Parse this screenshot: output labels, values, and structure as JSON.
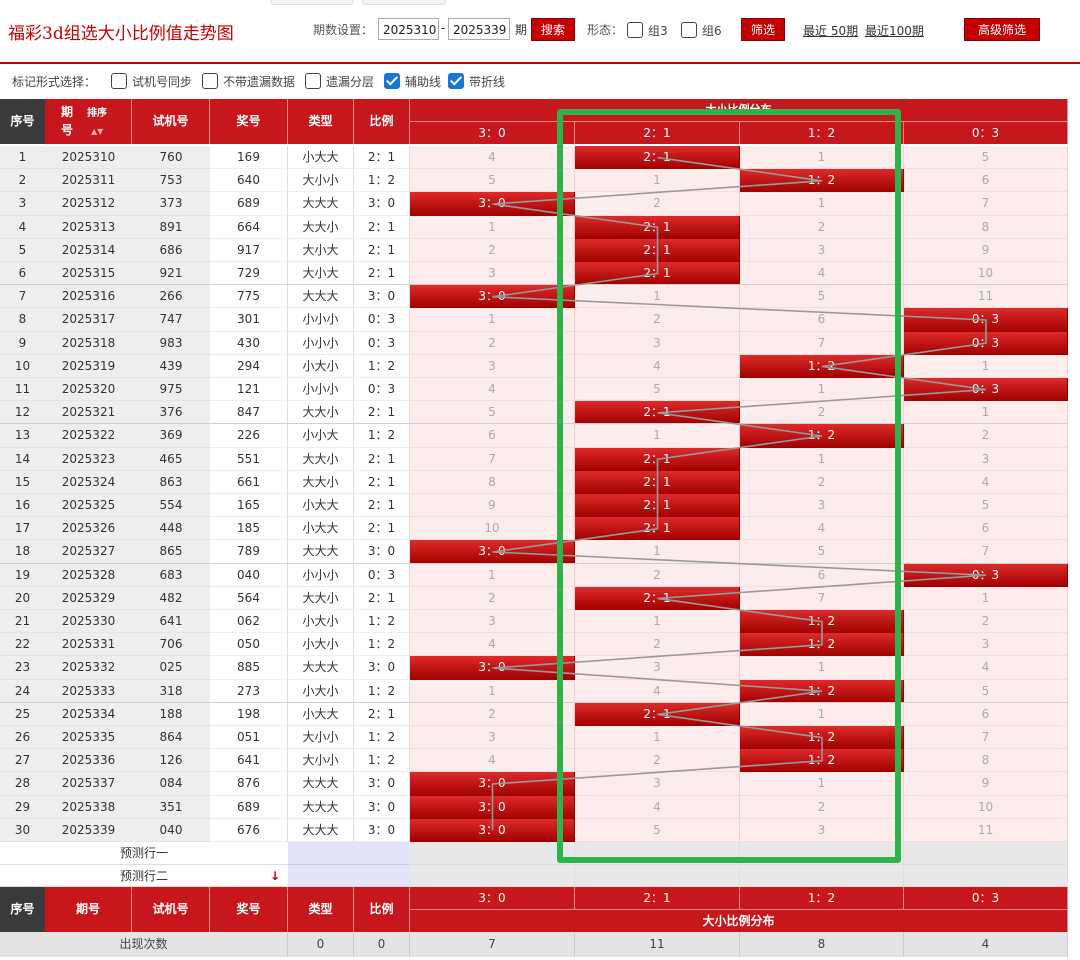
{
  "header": {
    "title": "福彩3d组选大小比例值走势图",
    "period_label": "期数设置：",
    "period_from": "2025310",
    "period_to": "2025339",
    "period_unit": "期",
    "search_button": "搜索",
    "shape_label": "形态：",
    "group3_label": "组3",
    "group6_label": "组6",
    "filter_button": "筛选",
    "recent50": "最近 50期",
    "recent100": "最近100期",
    "advanced_button": "高级筛选"
  },
  "options": {
    "label": "标记形式选择：",
    "items": [
      {
        "label": "试机号同步",
        "checked": false
      },
      {
        "label": "不带遗漏数据",
        "checked": false
      },
      {
        "label": "遗漏分层",
        "checked": false
      },
      {
        "label": "辅助线",
        "checked": true
      },
      {
        "label": "带折线",
        "checked": true
      }
    ]
  },
  "table": {
    "headers": {
      "seq": "序号",
      "period_a": "期",
      "period_b": "号",
      "sort": "排序",
      "trial": "试机号",
      "prize": "奖号",
      "type": "类型",
      "ratio": "比例",
      "dist_title": "大小比例分布"
    },
    "dist_columns": [
      "3：0",
      "2：1",
      "1：2",
      "0：3"
    ],
    "rows": [
      {
        "seq": "1",
        "period": "2025310",
        "trial": "760",
        "prize": "169",
        "type": "小大大",
        "ratio": "2：1",
        "hit": 1,
        "d": [
          "4",
          "2：1",
          "1",
          "5"
        ]
      },
      {
        "seq": "2",
        "period": "2025311",
        "trial": "753",
        "prize": "640",
        "type": "大小小",
        "ratio": "1：2",
        "hit": 2,
        "d": [
          "5",
          "1",
          "1：2",
          "6"
        ]
      },
      {
        "seq": "3",
        "period": "2025312",
        "trial": "373",
        "prize": "689",
        "type": "大大大",
        "ratio": "3：0",
        "hit": 0,
        "d": [
          "3：0",
          "2",
          "1",
          "7"
        ]
      },
      {
        "seq": "4",
        "period": "2025313",
        "trial": "891",
        "prize": "664",
        "type": "大大小",
        "ratio": "2：1",
        "hit": 1,
        "d": [
          "1",
          "2：1",
          "2",
          "8"
        ]
      },
      {
        "seq": "5",
        "period": "2025314",
        "trial": "686",
        "prize": "917",
        "type": "大小大",
        "ratio": "2：1",
        "hit": 1,
        "d": [
          "2",
          "2：1",
          "3",
          "9"
        ]
      },
      {
        "seq": "6",
        "period": "2025315",
        "trial": "921",
        "prize": "729",
        "type": "大小大",
        "ratio": "2：1",
        "hit": 1,
        "d": [
          "3",
          "2：1",
          "4",
          "10"
        ]
      },
      {
        "seq": "7",
        "period": "2025316",
        "trial": "266",
        "prize": "775",
        "type": "大大大",
        "ratio": "3：0",
        "hit": 0,
        "d": [
          "3：0",
          "1",
          "5",
          "11"
        ]
      },
      {
        "seq": "8",
        "period": "2025317",
        "trial": "747",
        "prize": "301",
        "type": "小小小",
        "ratio": "0：3",
        "hit": 3,
        "d": [
          "1",
          "2",
          "6",
          "0：3"
        ]
      },
      {
        "seq": "9",
        "period": "2025318",
        "trial": "983",
        "prize": "430",
        "type": "小小小",
        "ratio": "0：3",
        "hit": 3,
        "d": [
          "2",
          "3",
          "7",
          "0：3"
        ]
      },
      {
        "seq": "10",
        "period": "2025319",
        "trial": "439",
        "prize": "294",
        "type": "小大小",
        "ratio": "1：2",
        "hit": 2,
        "d": [
          "3",
          "4",
          "1：2",
          "1"
        ]
      },
      {
        "seq": "11",
        "period": "2025320",
        "trial": "975",
        "prize": "121",
        "type": "小小小",
        "ratio": "0：3",
        "hit": 3,
        "d": [
          "4",
          "5",
          "1",
          "0：3"
        ]
      },
      {
        "seq": "12",
        "period": "2025321",
        "trial": "376",
        "prize": "847",
        "type": "大大小",
        "ratio": "2：1",
        "hit": 1,
        "d": [
          "5",
          "2：1",
          "2",
          "1"
        ]
      },
      {
        "seq": "13",
        "period": "2025322",
        "trial": "369",
        "prize": "226",
        "type": "小小大",
        "ratio": "1：2",
        "hit": 2,
        "d": [
          "6",
          "1",
          "1：2",
          "2"
        ]
      },
      {
        "seq": "14",
        "period": "2025323",
        "trial": "465",
        "prize": "551",
        "type": "大大小",
        "ratio": "2：1",
        "hit": 1,
        "d": [
          "7",
          "2：1",
          "1",
          "3"
        ]
      },
      {
        "seq": "15",
        "period": "2025324",
        "trial": "863",
        "prize": "661",
        "type": "大大小",
        "ratio": "2：1",
        "hit": 1,
        "d": [
          "8",
          "2：1",
          "2",
          "4"
        ]
      },
      {
        "seq": "16",
        "period": "2025325",
        "trial": "554",
        "prize": "165",
        "type": "小大大",
        "ratio": "2：1",
        "hit": 1,
        "d": [
          "9",
          "2：1",
          "3",
          "5"
        ]
      },
      {
        "seq": "17",
        "period": "2025326",
        "trial": "448",
        "prize": "185",
        "type": "小大大",
        "ratio": "2：1",
        "hit": 1,
        "d": [
          "10",
          "2：1",
          "4",
          "6"
        ]
      },
      {
        "seq": "18",
        "period": "2025327",
        "trial": "865",
        "prize": "789",
        "type": "大大大",
        "ratio": "3：0",
        "hit": 0,
        "d": [
          "3：0",
          "1",
          "5",
          "7"
        ]
      },
      {
        "seq": "19",
        "period": "2025328",
        "trial": "683",
        "prize": "040",
        "type": "小小小",
        "ratio": "0：3",
        "hit": 3,
        "d": [
          "1",
          "2",
          "6",
          "0：3"
        ]
      },
      {
        "seq": "20",
        "period": "2025329",
        "trial": "482",
        "prize": "564",
        "type": "大大小",
        "ratio": "2：1",
        "hit": 1,
        "d": [
          "2",
          "2：1",
          "7",
          "1"
        ]
      },
      {
        "seq": "21",
        "period": "2025330",
        "trial": "641",
        "prize": "062",
        "type": "小大小",
        "ratio": "1：2",
        "hit": 2,
        "d": [
          "3",
          "1",
          "1：2",
          "2"
        ]
      },
      {
        "seq": "22",
        "period": "2025331",
        "trial": "706",
        "prize": "050",
        "type": "小大小",
        "ratio": "1：2",
        "hit": 2,
        "d": [
          "4",
          "2",
          "1：2",
          "3"
        ]
      },
      {
        "seq": "23",
        "period": "2025332",
        "trial": "025",
        "prize": "885",
        "type": "大大大",
        "ratio": "3：0",
        "hit": 0,
        "d": [
          "3：0",
          "3",
          "1",
          "4"
        ]
      },
      {
        "seq": "24",
        "period": "2025333",
        "trial": "318",
        "prize": "273",
        "type": "小大小",
        "ratio": "1：2",
        "hit": 2,
        "d": [
          "1",
          "4",
          "1：2",
          "5"
        ]
      },
      {
        "seq": "25",
        "period": "2025334",
        "trial": "188",
        "prize": "198",
        "type": "小大大",
        "ratio": "2：1",
        "hit": 1,
        "d": [
          "2",
          "2：1",
          "1",
          "6"
        ]
      },
      {
        "seq": "26",
        "period": "2025335",
        "trial": "864",
        "prize": "051",
        "type": "大小小",
        "ratio": "1：2",
        "hit": 2,
        "d": [
          "3",
          "1",
          "1：2",
          "7"
        ]
      },
      {
        "seq": "27",
        "period": "2025336",
        "trial": "126",
        "prize": "641",
        "type": "大小小",
        "ratio": "1：2",
        "hit": 2,
        "d": [
          "4",
          "2",
          "1：2",
          "8"
        ]
      },
      {
        "seq": "28",
        "period": "2025337",
        "trial": "084",
        "prize": "876",
        "type": "大大大",
        "ratio": "3：0",
        "hit": 0,
        "d": [
          "3：0",
          "3",
          "1",
          "9"
        ]
      },
      {
        "seq": "29",
        "period": "2025338",
        "trial": "351",
        "prize": "689",
        "type": "大大大",
        "ratio": "3：0",
        "hit": 0,
        "d": [
          "3：0",
          "4",
          "2",
          "10"
        ]
      },
      {
        "seq": "30",
        "period": "2025339",
        "trial": "040",
        "prize": "676",
        "type": "大大大",
        "ratio": "3：0",
        "hit": 0,
        "d": [
          "3：0",
          "5",
          "3",
          "11"
        ]
      }
    ],
    "predict1": "预测行一",
    "predict2": "预测行二",
    "footer": {
      "seq": "序号",
      "period": "期号",
      "trial": "试机号",
      "prize": "奖号",
      "type": "类型",
      "ratio": "比例",
      "dist_title": "大小比例分布",
      "count_label": "出现次数",
      "count_type": "0",
      "count_ratio": "0",
      "counts": [
        "7",
        "11",
        "8",
        "4"
      ]
    }
  },
  "colors": {
    "accent": "#c8161d",
    "highlight_box": "#2db34a",
    "trend_line": "#999999"
  }
}
